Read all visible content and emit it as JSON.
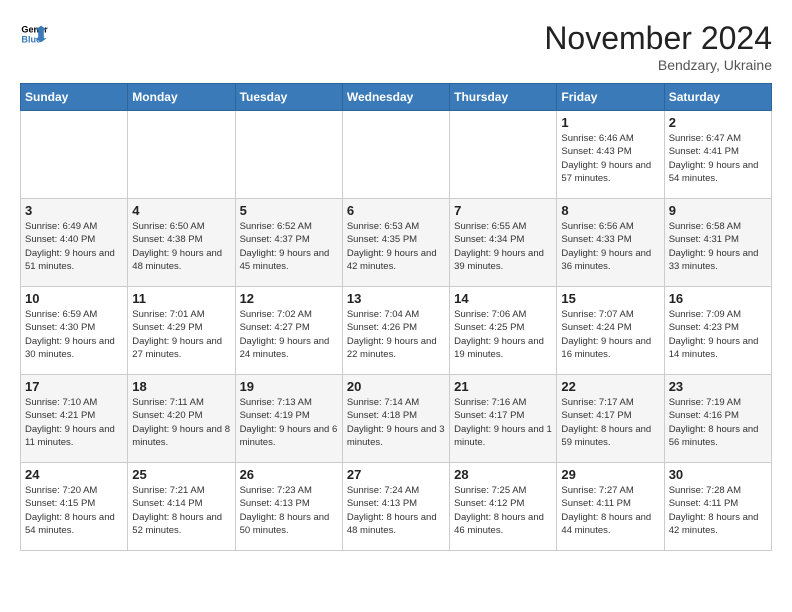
{
  "header": {
    "logo_general": "General",
    "logo_blue": "Blue",
    "title": "November 2024",
    "subtitle": "Bendzary, Ukraine"
  },
  "days_of_week": [
    "Sunday",
    "Monday",
    "Tuesday",
    "Wednesday",
    "Thursday",
    "Friday",
    "Saturday"
  ],
  "weeks": [
    [
      {
        "day": "",
        "info": ""
      },
      {
        "day": "",
        "info": ""
      },
      {
        "day": "",
        "info": ""
      },
      {
        "day": "",
        "info": ""
      },
      {
        "day": "",
        "info": ""
      },
      {
        "day": "1",
        "info": "Sunrise: 6:46 AM\nSunset: 4:43 PM\nDaylight: 9 hours and 57 minutes."
      },
      {
        "day": "2",
        "info": "Sunrise: 6:47 AM\nSunset: 4:41 PM\nDaylight: 9 hours and 54 minutes."
      }
    ],
    [
      {
        "day": "3",
        "info": "Sunrise: 6:49 AM\nSunset: 4:40 PM\nDaylight: 9 hours and 51 minutes."
      },
      {
        "day": "4",
        "info": "Sunrise: 6:50 AM\nSunset: 4:38 PM\nDaylight: 9 hours and 48 minutes."
      },
      {
        "day": "5",
        "info": "Sunrise: 6:52 AM\nSunset: 4:37 PM\nDaylight: 9 hours and 45 minutes."
      },
      {
        "day": "6",
        "info": "Sunrise: 6:53 AM\nSunset: 4:35 PM\nDaylight: 9 hours and 42 minutes."
      },
      {
        "day": "7",
        "info": "Sunrise: 6:55 AM\nSunset: 4:34 PM\nDaylight: 9 hours and 39 minutes."
      },
      {
        "day": "8",
        "info": "Sunrise: 6:56 AM\nSunset: 4:33 PM\nDaylight: 9 hours and 36 minutes."
      },
      {
        "day": "9",
        "info": "Sunrise: 6:58 AM\nSunset: 4:31 PM\nDaylight: 9 hours and 33 minutes."
      }
    ],
    [
      {
        "day": "10",
        "info": "Sunrise: 6:59 AM\nSunset: 4:30 PM\nDaylight: 9 hours and 30 minutes."
      },
      {
        "day": "11",
        "info": "Sunrise: 7:01 AM\nSunset: 4:29 PM\nDaylight: 9 hours and 27 minutes."
      },
      {
        "day": "12",
        "info": "Sunrise: 7:02 AM\nSunset: 4:27 PM\nDaylight: 9 hours and 24 minutes."
      },
      {
        "day": "13",
        "info": "Sunrise: 7:04 AM\nSunset: 4:26 PM\nDaylight: 9 hours and 22 minutes."
      },
      {
        "day": "14",
        "info": "Sunrise: 7:06 AM\nSunset: 4:25 PM\nDaylight: 9 hours and 19 minutes."
      },
      {
        "day": "15",
        "info": "Sunrise: 7:07 AM\nSunset: 4:24 PM\nDaylight: 9 hours and 16 minutes."
      },
      {
        "day": "16",
        "info": "Sunrise: 7:09 AM\nSunset: 4:23 PM\nDaylight: 9 hours and 14 minutes."
      }
    ],
    [
      {
        "day": "17",
        "info": "Sunrise: 7:10 AM\nSunset: 4:21 PM\nDaylight: 9 hours and 11 minutes."
      },
      {
        "day": "18",
        "info": "Sunrise: 7:11 AM\nSunset: 4:20 PM\nDaylight: 9 hours and 8 minutes."
      },
      {
        "day": "19",
        "info": "Sunrise: 7:13 AM\nSunset: 4:19 PM\nDaylight: 9 hours and 6 minutes."
      },
      {
        "day": "20",
        "info": "Sunrise: 7:14 AM\nSunset: 4:18 PM\nDaylight: 9 hours and 3 minutes."
      },
      {
        "day": "21",
        "info": "Sunrise: 7:16 AM\nSunset: 4:17 PM\nDaylight: 9 hours and 1 minute."
      },
      {
        "day": "22",
        "info": "Sunrise: 7:17 AM\nSunset: 4:17 PM\nDaylight: 8 hours and 59 minutes."
      },
      {
        "day": "23",
        "info": "Sunrise: 7:19 AM\nSunset: 4:16 PM\nDaylight: 8 hours and 56 minutes."
      }
    ],
    [
      {
        "day": "24",
        "info": "Sunrise: 7:20 AM\nSunset: 4:15 PM\nDaylight: 8 hours and 54 minutes."
      },
      {
        "day": "25",
        "info": "Sunrise: 7:21 AM\nSunset: 4:14 PM\nDaylight: 8 hours and 52 minutes."
      },
      {
        "day": "26",
        "info": "Sunrise: 7:23 AM\nSunset: 4:13 PM\nDaylight: 8 hours and 50 minutes."
      },
      {
        "day": "27",
        "info": "Sunrise: 7:24 AM\nSunset: 4:13 PM\nDaylight: 8 hours and 48 minutes."
      },
      {
        "day": "28",
        "info": "Sunrise: 7:25 AM\nSunset: 4:12 PM\nDaylight: 8 hours and 46 minutes."
      },
      {
        "day": "29",
        "info": "Sunrise: 7:27 AM\nSunset: 4:11 PM\nDaylight: 8 hours and 44 minutes."
      },
      {
        "day": "30",
        "info": "Sunrise: 7:28 AM\nSunset: 4:11 PM\nDaylight: 8 hours and 42 minutes."
      }
    ]
  ]
}
